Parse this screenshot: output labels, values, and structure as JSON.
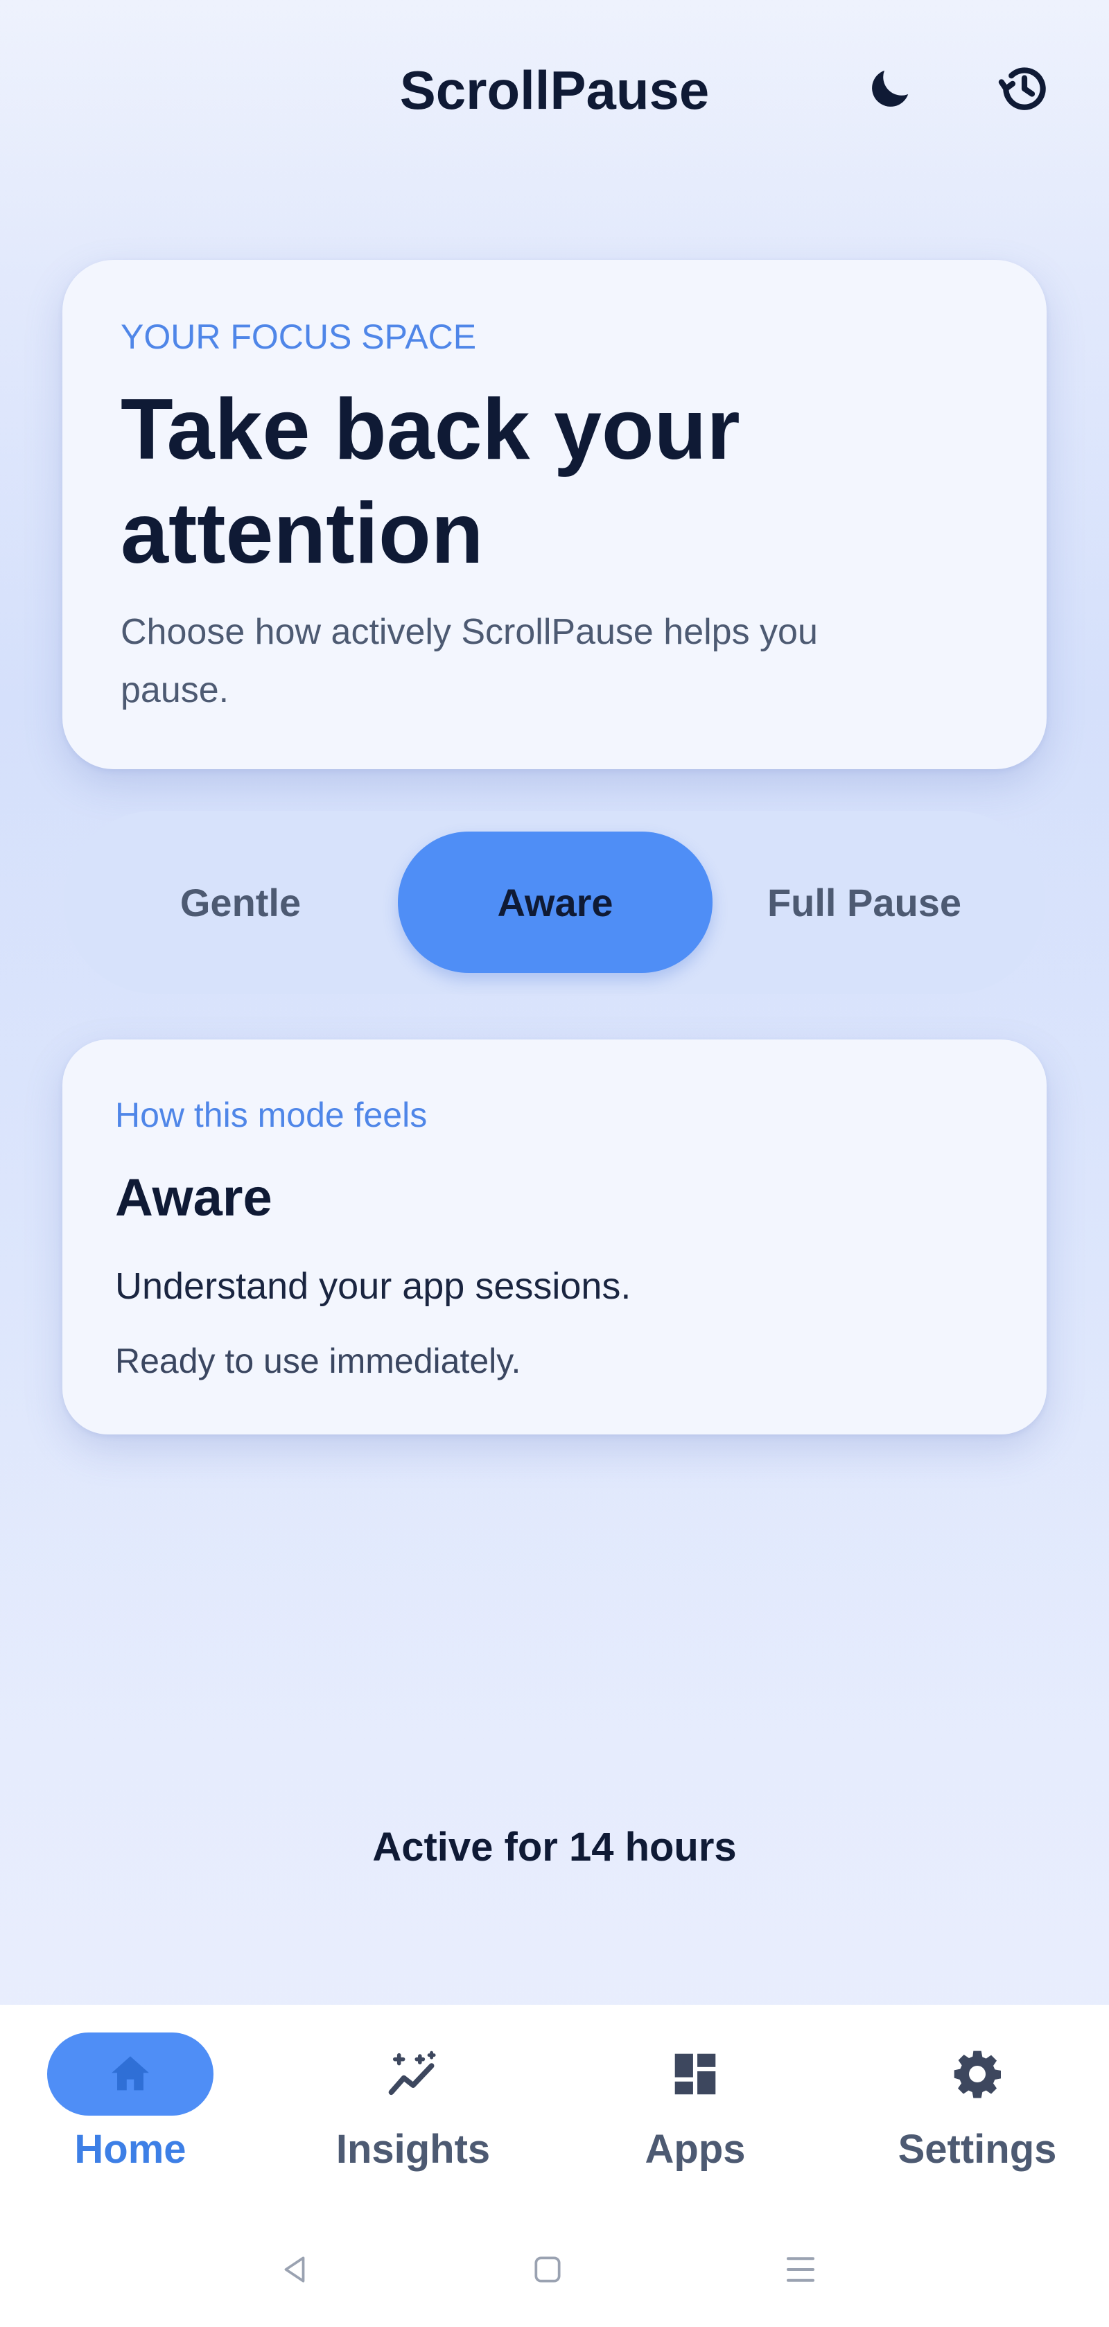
{
  "header": {
    "title": "ScrollPause",
    "moon_icon": "moon-icon",
    "history_icon": "history-icon"
  },
  "hero": {
    "eyebrow": "YOUR FOCUS SPACE",
    "title": "Take back your attention",
    "subtitle": "Choose how actively ScrollPause helps you pause."
  },
  "modes": {
    "options": [
      "Gentle",
      "Aware",
      "Full Pause"
    ],
    "selected": "Aware"
  },
  "mode_card": {
    "eyebrow": "How this mode feels",
    "name": "Aware",
    "description": "Understand your app sessions.",
    "status": "Ready to use immediately."
  },
  "status": {
    "active_text": "Active for 14 hours"
  },
  "nav": {
    "items": [
      {
        "label": "Home",
        "icon": "home-icon",
        "active": true
      },
      {
        "label": "Insights",
        "icon": "insights-icon",
        "active": false
      },
      {
        "label": "Apps",
        "icon": "apps-grid-icon",
        "active": false
      },
      {
        "label": "Settings",
        "icon": "gear-icon",
        "active": false
      }
    ]
  },
  "colors": {
    "accent": "#4f8ef6",
    "accent_text": "#3d7fe6",
    "text_dark": "#0f1a35",
    "text_muted": "#4d5a72",
    "background": "#dde6fc",
    "card": "#f3f6fe"
  }
}
